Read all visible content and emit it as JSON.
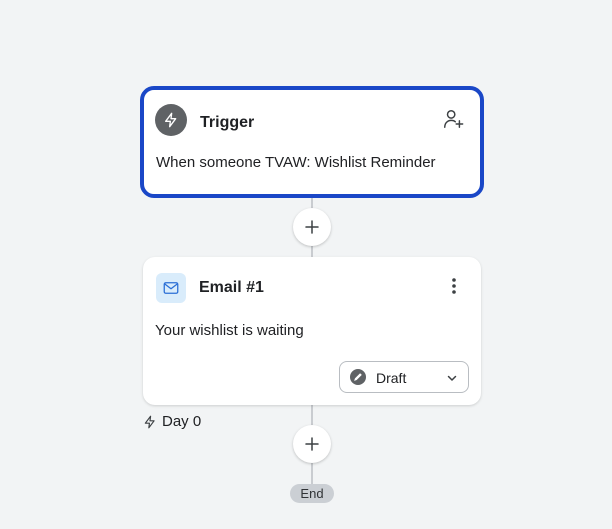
{
  "trigger": {
    "title": "Trigger",
    "description": "When someone TVAW: Wishlist Reminder",
    "icon": "lightning-icon",
    "action_icon": "user-plus-icon"
  },
  "email": {
    "title": "Email #1",
    "description": "Your wishlist is waiting",
    "icon": "mail-icon",
    "menu_icon": "more-vertical-icon",
    "status": {
      "label": "Draft",
      "icon": "pencil-icon"
    }
  },
  "delay": {
    "label": "Day 0",
    "icon": "lightning-icon"
  },
  "end": {
    "label": "End"
  },
  "colors": {
    "background": "#f2f4f5",
    "selected_border": "#1a47c7",
    "icon_dark": "#5f6265",
    "email_icon_bg": "#d9ecfb",
    "email_icon_stroke": "#2b6fd6",
    "connector": "#c9ccd0",
    "end_pill": "#cbcfd4"
  }
}
